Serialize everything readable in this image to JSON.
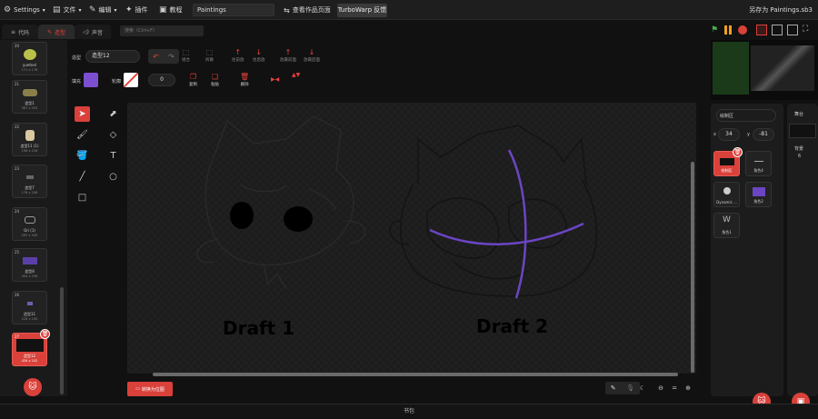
{
  "menu": {
    "settings": "Settings",
    "file": "文件",
    "edit": "编辑",
    "addons": "插件",
    "tutorials": "教程",
    "project_title": "Paintings",
    "see_project_page": "查看作品页面",
    "turbowarp_feedback": "TurboWarp 反馈",
    "save_as": "另存为 Paintings.sb3"
  },
  "tabs": {
    "code": "代码",
    "costumes": "造型",
    "sounds": "声音"
  },
  "search_placeholder": "搜索（Ctrl+F）",
  "costumes": [
    {
      "num": "20",
      "name": "yuetnel",
      "size": "171 x 176"
    },
    {
      "num": "21",
      "name": "造型1",
      "size": "387 x 203"
    },
    {
      "num": "22",
      "name": "造型11 (1)",
      "size": "196 x 236"
    },
    {
      "num": "23",
      "name": "造型7",
      "size": "176 x 206"
    },
    {
      "num": "24",
      "name": "Ori (1)",
      "size": "267 x 349"
    },
    {
      "num": "25",
      "name": "造型8",
      "size": "404 x 256"
    },
    {
      "num": "26",
      "name": "造型11",
      "size": "228 x 190"
    },
    {
      "num": "27",
      "name": "造型12",
      "size": "426 x 242"
    }
  ],
  "editor": {
    "costume_label": "造型",
    "costume_name": "造型12",
    "fill_label": "填充",
    "outline_label": "轮廓",
    "outline_width": "0",
    "fill_color": "#7b4fd0",
    "undo_label": "↶",
    "redo_label": "↷",
    "group": "组合",
    "ungroup": "拆散",
    "forward": "往前放",
    "backward": "往后放",
    "front": "放最前面",
    "back": "放最后面",
    "copy": "复制",
    "paste": "粘贴",
    "delete": "删除",
    "flip_h": "▶◀",
    "flip_v": "▲▼",
    "convert": "转换为位图",
    "draft1": "Draft 1",
    "draft2": "Draft 2"
  },
  "sprite_panel": {
    "sprite_label": "绘制区",
    "x_label": "x",
    "x": "34",
    "y_label": "y",
    "y": "-81",
    "sprites": [
      {
        "name": "绘制区"
      },
      {
        "name": "角色4"
      },
      {
        "name": "Dynamic ..."
      },
      {
        "name": "角色2"
      },
      {
        "name": "角色1"
      }
    ],
    "stage_label": "舞台",
    "backdrops_label": "背景",
    "backdrops_count": "6"
  },
  "bottom_bar": "书包",
  "colors": {
    "accent": "#d9413a",
    "purple": "#7a4fb8"
  },
  "icons": [
    "settings-icon",
    "file-icon",
    "edit-icon",
    "addons-icon",
    "tutorials-icon",
    "green-flag-icon",
    "pause-icon",
    "stop-icon"
  ]
}
